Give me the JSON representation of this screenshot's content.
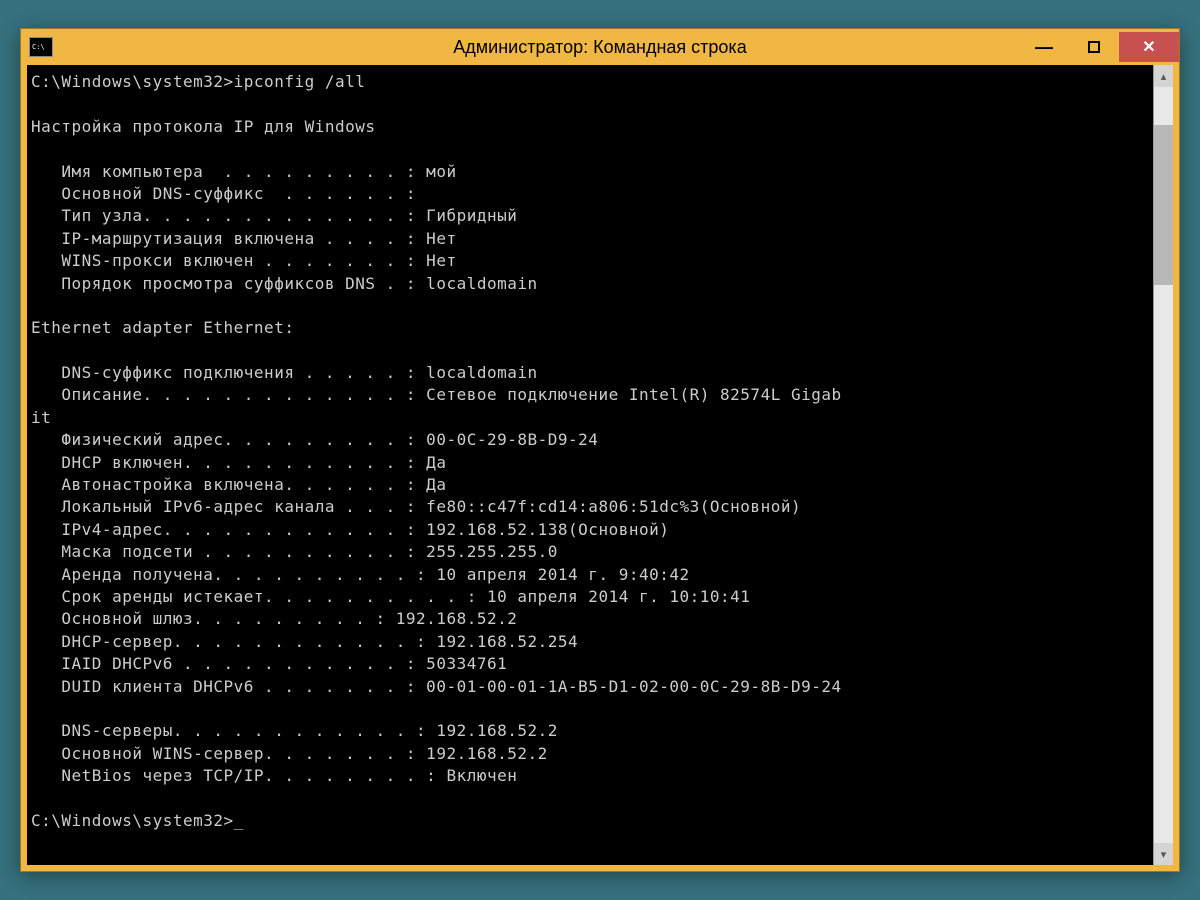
{
  "window": {
    "title": "Администратор: Командная строка"
  },
  "terminal": {
    "prompt1": "C:\\Windows\\system32>ipconfig /all",
    "blank": "",
    "header": "Настройка протокола IP для Windows",
    "hostname": "   Имя компьютера  . . . . . . . . . : мой",
    "dns_suffix": "   Основной DNS-суффикс  . . . . . . :",
    "node_type": "   Тип узла. . . . . . . . . . . . . : Гибридный",
    "ip_routing": "   IP-маршрутизация включена . . . . : Нет",
    "wins_proxy": "   WINS-прокси включен . . . . . . . : Нет",
    "dns_search": "   Порядок просмотра суффиксов DNS . : localdomain",
    "adapter_header": "Ethernet adapter Ethernet:",
    "conn_suffix": "   DNS-суффикс подключения . . . . . : localdomain",
    "description": "   Описание. . . . . . . . . . . . . : Сетевое подключение Intel(R) 82574L Gigab",
    "desc_wrap": "it",
    "phys_addr": "   Физический адрес. . . . . . . . . : 00-0C-29-8B-D9-24",
    "dhcp_enabled": "   DHCP включен. . . . . . . . . . . : Да",
    "autoconf": "   Автонастройка включена. . . . . . : Да",
    "ipv6_local": "   Локальный IPv6-адрес канала . . . : fe80::c47f:cd14:a806:51dc%3(Основной)",
    "ipv4": "   IPv4-адрес. . . . . . . . . . . . : 192.168.52.138(Основной)",
    "subnet": "   Маска подсети . . . . . . . . . . : 255.255.255.0",
    "lease_obtained": "   Аренда получена. . . . . . . . . . : 10 апреля 2014 г. 9:40:42",
    "lease_expires": "   Срок аренды истекает. . . . . . . . . . : 10 апреля 2014 г. 10:10:41",
    "gateway": "   Основной шлюз. . . . . . . . . : 192.168.52.2",
    "dhcp_server": "   DHCP-сервер. . . . . . . . . . . . : 192.168.52.254",
    "iaid": "   IAID DHCPv6 . . . . . . . . . . . : 50334761",
    "duid": "   DUID клиента DHCPv6 . . . . . . . : 00-01-00-01-1A-B5-D1-02-00-0C-29-8B-D9-24",
    "dns_servers": "   DNS-серверы. . . . . . . . . . . . : 192.168.52.2",
    "wins_server": "   Основной WINS-сервер. . . . . . . : 192.168.52.2",
    "netbios": "   NetBios через TCP/IP. . . . . . . . : Включен",
    "prompt2": "C:\\Windows\\system32>_"
  }
}
